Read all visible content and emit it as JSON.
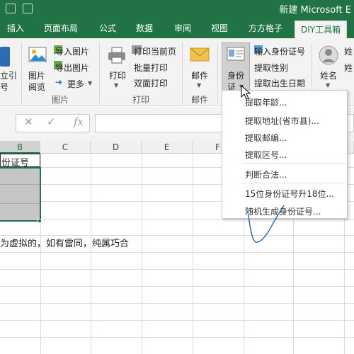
{
  "window": {
    "title": "新建 Microsoft E"
  },
  "tabs": [
    "插入",
    "页面布局",
    "公式",
    "数据",
    "审阅",
    "视图",
    "方方格子",
    "DIY工具箱"
  ],
  "ribbon": {
    "left_partial": {
      "line1": "立引",
      "line2": "号"
    },
    "image_group": {
      "label": "图片",
      "browse_button": {
        "line1": "图片",
        "line2": "阅览"
      },
      "import_image": "导入图片",
      "export_image": "导出图片",
      "more": "更多"
    },
    "print_group": {
      "label": "打印",
      "print_button": "打印",
      "print_current_page": "打印当前页",
      "batch_print": "批量打印",
      "duplex_print": "双面打印"
    },
    "mail_group": {
      "label": "邮件",
      "mail_button": "邮件"
    },
    "id_group": {
      "id_button": {
        "line1": "身份",
        "line2": "证"
      },
      "input_id": "输入身份证号",
      "extract_gender": "提取性别",
      "extract_birthdate": "提取出生日期"
    },
    "name_group": {
      "name_button": "姓名",
      "partial1": "姓",
      "partial2": "姓"
    }
  },
  "formula_bar": {
    "cancel_symbol": "✕",
    "confirm_symbol": "✓",
    "fx_symbol": "fx"
  },
  "sheet": {
    "columns": [
      "B",
      "C",
      "D",
      "E",
      "F"
    ],
    "cell_header_text": "份证号",
    "note_text": "为虚拟的，如有雷同，纯属巧合"
  },
  "dropdown_menu": {
    "items": [
      "提取年龄...",
      "提取地址(省市县)...",
      "提取邮编...",
      "提取区号...",
      "判断合法...",
      "15位身份证号升18位...",
      "随机生成身份证号..."
    ]
  },
  "colors": {
    "accent": "#217346",
    "ribbon_bg": "#f3f3f3",
    "selection_fill": "#c6c6c6"
  }
}
